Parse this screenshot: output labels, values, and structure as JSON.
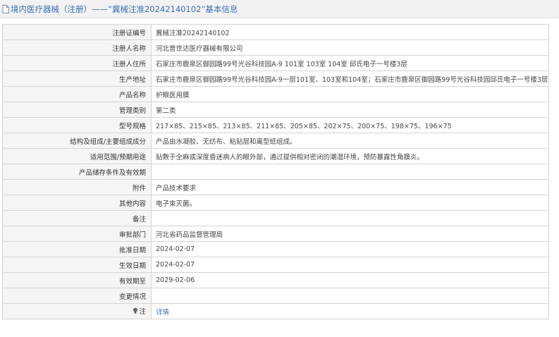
{
  "header": {
    "title": "境内医疗器械（注册）——“冀械注准20242140102”基本信息"
  },
  "rows": [
    {
      "label": "注册证编号",
      "value": "冀械注准20242140102"
    },
    {
      "label": "注册人名称",
      "value": "河北普世达医疗器械有限公司"
    },
    {
      "label": "注册人住所",
      "value": "石家庄市鹿泉区御园路99号光谷科技园A-9 101室 103室 104室 邱氏电子一号楼3层"
    },
    {
      "label": "生产地址",
      "value": "石家庄市鹿泉区御园路99号光谷科技园A-9一层101室、103室和104室；石家庄市鹿泉区御园路99号光谷科技园邱氏电子一号楼3层"
    },
    {
      "label": "产品名称",
      "value": "护眼医用膜"
    },
    {
      "label": "管理类别",
      "value": "第二类"
    },
    {
      "label": "型号规格",
      "value": "217×85、215×85、213×85、211×85、205×85、202×75、200×75、198×75、196×75"
    },
    {
      "label": "结构及组成/主要组成成分",
      "value": "产品由水凝胶、无纺布、粘贴层和离型纸组成。"
    },
    {
      "label": "适用范围/预期用途",
      "value": "贴敷于全麻或深度昏迷病人的眼外部，通过提供相对密闭的潮湿环境，预防暴露性角膜炎。"
    },
    {
      "label": "产品储存条件及有效期",
      "value": ""
    },
    {
      "label": "附件",
      "value": "产品技术要求"
    },
    {
      "label": "其他内容",
      "value": "电子束灭菌。"
    },
    {
      "label": "备注",
      "value": ""
    },
    {
      "label": "审批部门",
      "value": "河北省药品监督管理局"
    },
    {
      "label": "批准日期",
      "value": "2024-02-07"
    },
    {
      "label": "生效日期",
      "value": "2024-02-07"
    },
    {
      "label": "有效期至",
      "value": "2029-02-06"
    },
    {
      "label": "变更情况",
      "value": ""
    }
  ],
  "note_row": {
    "label": "注",
    "link_text": "详情",
    "icon": "bulb-icon"
  },
  "colors": {
    "title_color": "#3a6fb0",
    "link_color": "#3a6fb0",
    "label_bg": "#f5f5f5",
    "border": "#d4d4d4"
  }
}
